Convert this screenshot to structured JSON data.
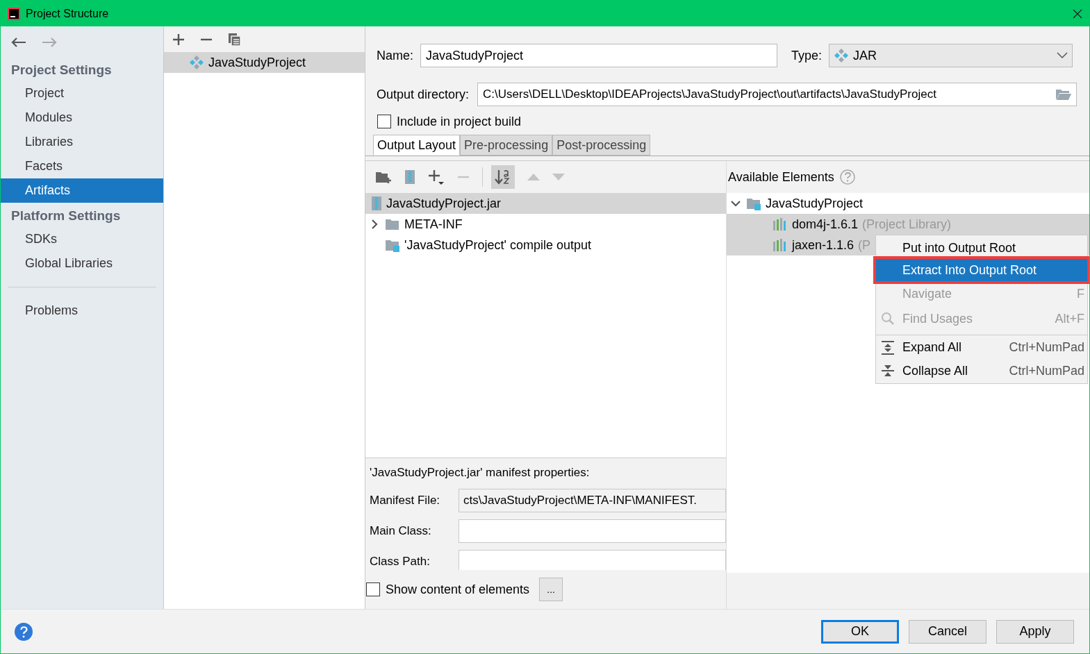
{
  "window": {
    "title": "Project Structure"
  },
  "sidebar": {
    "sections": [
      {
        "title": "Project Settings",
        "items": [
          {
            "label": "Project",
            "selected": false
          },
          {
            "label": "Modules",
            "selected": false
          },
          {
            "label": "Libraries",
            "selected": false
          },
          {
            "label": "Facets",
            "selected": false
          },
          {
            "label": "Artifacts",
            "selected": true
          }
        ]
      },
      {
        "title": "Platform Settings",
        "items": [
          {
            "label": "SDKs",
            "selected": false
          },
          {
            "label": "Global Libraries",
            "selected": false
          }
        ]
      }
    ],
    "bottom_items": [
      {
        "label": "Problems",
        "selected": false
      }
    ]
  },
  "artifacts": [
    {
      "name": "JavaStudyProject",
      "selected": true
    }
  ],
  "form": {
    "name_label": "Name:",
    "name": "JavaStudyProject",
    "type_label": "Type:",
    "type": "JAR",
    "output_label": "Output directory:",
    "output_directory": "C:\\Users\\DELL\\Desktop\\IDEAProjects\\JavaStudyProject\\out\\artifacts\\JavaStudyProject",
    "include_label": "Include in project build",
    "include_checked": false
  },
  "tabs": [
    {
      "label": "Output Layout",
      "selected": true
    },
    {
      "label": "Pre-processing",
      "selected": false
    },
    {
      "label": "Post-processing",
      "selected": false
    }
  ],
  "output_tree": [
    {
      "label": "JavaStudyProject.jar",
      "kind": "jar",
      "selected": true
    },
    {
      "label": "META-INF",
      "kind": "folder",
      "selected": false,
      "expanded": false
    },
    {
      "label": "'JavaStudyProject' compile output",
      "kind": "module",
      "selected": false
    }
  ],
  "available": {
    "title": "Available Elements",
    "tree": [
      {
        "label": "JavaStudyProject",
        "kind": "module",
        "expanded": true,
        "selected": false,
        "children": [
          {
            "label": "dom4j-1.6.1",
            "note": "(Project Library)",
            "kind": "library",
            "selected": true
          },
          {
            "label": "jaxen-1.1.6",
            "note": "(P",
            "kind": "library",
            "selected": true
          }
        ]
      }
    ]
  },
  "context_menu": [
    {
      "label": "Put into Output Root",
      "kind": "item",
      "selected": false,
      "disabled": false
    },
    {
      "label": "Extract Into Output Root",
      "kind": "item",
      "selected": true,
      "disabled": false
    },
    {
      "label": "Navigate",
      "shortcut": "F",
      "kind": "item",
      "selected": false,
      "disabled": true
    },
    {
      "label": "Find Usages",
      "shortcut": "Alt+F",
      "kind": "search",
      "selected": false,
      "disabled": true
    },
    {
      "label": "Expand All",
      "shortcut": "Ctrl+NumPad",
      "kind": "expand",
      "selected": false,
      "disabled": false
    },
    {
      "label": "Collapse All",
      "shortcut": "Ctrl+NumPad",
      "kind": "collapse",
      "selected": false,
      "disabled": false
    }
  ],
  "manifest": {
    "title": "'JavaStudyProject.jar' manifest properties:",
    "fields": [
      {
        "label": "Manifest File:",
        "value": "cts\\JavaStudyProject\\META-INF\\MANIFEST."
      },
      {
        "label": "Main Class:"
      },
      {
        "label": "Class Path:"
      }
    ]
  },
  "show_content": {
    "label": "Show content of elements",
    "checked": false,
    "button": "..."
  },
  "buttons": [
    {
      "label": "OK",
      "default": true
    },
    {
      "label": "Cancel",
      "default": false
    },
    {
      "label": "Apply",
      "default": false
    }
  ]
}
